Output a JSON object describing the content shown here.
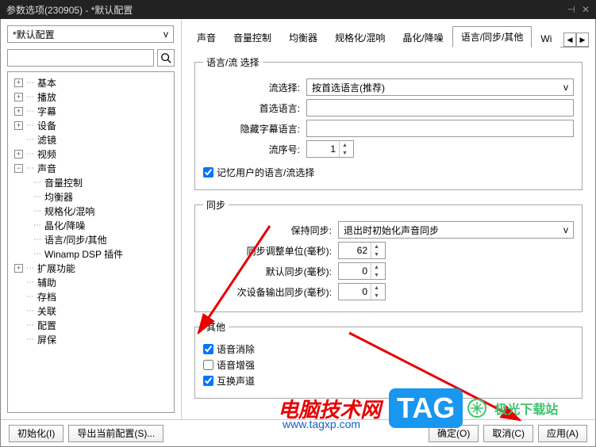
{
  "window": {
    "title": "参数选项(230905) - *默认配置"
  },
  "left": {
    "config_dropdown": "*默认配置",
    "tree": {
      "basic": "基本",
      "play": "播放",
      "subtitle": "字幕",
      "device": "设备",
      "filter": "滤镜",
      "video": "视频",
      "sound": "声音",
      "sound_children": {
        "volume": "音量控制",
        "eq": "均衡器",
        "normalize": "规格化/混响",
        "crystal": "晶化/降噪",
        "language": "语言/同步/其他",
        "winamp": "Winamp DSP 插件"
      },
      "extend": "扩展功能",
      "assist": "辅助",
      "archive": "存档",
      "assoc": "关联",
      "config": "配置",
      "screensaver": "屏保"
    }
  },
  "tabs": {
    "sound": "声音",
    "volume": "音量控制",
    "eq": "均衡器",
    "normalize": "规格化/混响",
    "crystal": "晶化/降噪",
    "language": "语言/同步/其他",
    "wi": "Wi"
  },
  "lang_group": {
    "legend": "语言/流 选择",
    "stream_select_label": "流选择:",
    "stream_select_value": "按首选语言(推荐)",
    "pref_lang_label": "首选语言:",
    "hide_sub_label": "隐藏字幕语言:",
    "stream_no_label": "流序号:",
    "stream_no_value": "1",
    "remember_label": "记忆用户的语言/流选择"
  },
  "sync_group": {
    "legend": "同步",
    "keep_sync_label": "保持同步:",
    "keep_sync_value": "退出时初始化声音同步",
    "adjust_unit_label": "同步调整单位(毫秒):",
    "adjust_unit_value": "62",
    "default_sync_label": "默认同步(毫秒):",
    "default_sync_value": "0",
    "secondary_sync_label": "次设备输出同步(毫秒):",
    "secondary_sync_value": "0"
  },
  "other_group": {
    "legend": "其他",
    "voice_removal": "语音消除",
    "voice_enhance": "语音增强",
    "swap_channels": "互换声道"
  },
  "buttons": {
    "init": "初始化(I)",
    "export": "导出当前配置(S)...",
    "ok": "确定(O)",
    "cancel": "取消(C)",
    "apply": "应用(A)"
  },
  "watermark": {
    "brand": "电脑技术网",
    "url": "www.tagxp.com",
    "tag": "TAG",
    "jiguang": "极光下载站"
  }
}
